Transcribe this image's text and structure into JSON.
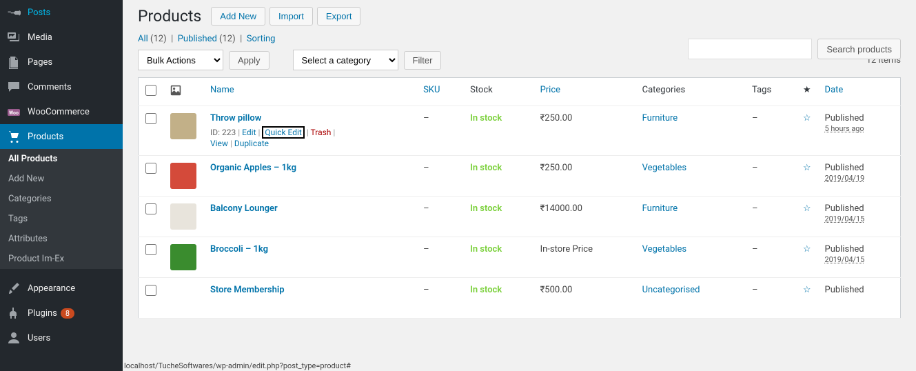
{
  "sidebar": {
    "items": [
      {
        "label": "Posts",
        "icon": "pin"
      },
      {
        "label": "Media",
        "icon": "media"
      },
      {
        "label": "Pages",
        "icon": "pages"
      },
      {
        "label": "Comments",
        "icon": "comment"
      },
      {
        "label": "WooCommerce",
        "icon": "woo"
      },
      {
        "label": "Products",
        "icon": "cart",
        "current": true
      },
      {
        "label": "Appearance",
        "icon": "brush"
      },
      {
        "label": "Plugins",
        "icon": "plug",
        "badge": "8"
      },
      {
        "label": "Users",
        "icon": "user"
      }
    ],
    "submenu": [
      {
        "label": "All Products",
        "current": true
      },
      {
        "label": "Add New"
      },
      {
        "label": "Categories"
      },
      {
        "label": "Tags"
      },
      {
        "label": "Attributes"
      },
      {
        "label": "Product Im-Ex"
      }
    ]
  },
  "header": {
    "title": "Products",
    "add_new": "Add New",
    "import": "Import",
    "export": "Export"
  },
  "filters": {
    "all_label": "All",
    "all_count": "(12)",
    "published_label": "Published",
    "published_count": "(12)",
    "sorting": "Sorting",
    "bulk_actions": "Bulk Actions",
    "apply": "Apply",
    "select_category": "Select a category",
    "filter": "Filter",
    "displaying": "12 items"
  },
  "search": {
    "button": "Search products"
  },
  "columns": {
    "name": "Name",
    "sku": "SKU",
    "stock": "Stock",
    "price": "Price",
    "categories": "Categories",
    "tags": "Tags",
    "date": "Date"
  },
  "row_actions": {
    "id_prefix": "ID: ",
    "edit": "Edit",
    "quick_edit": "Quick Edit",
    "trash": "Trash",
    "view": "View",
    "duplicate": "Duplicate"
  },
  "products": [
    {
      "name": "Throw pillow",
      "id": "223",
      "sku": "–",
      "stock": "In stock",
      "price": "₹250.00",
      "category": "Furniture",
      "tags": "–",
      "pub": "Published",
      "date": "5 hours ago",
      "thumb": "#c2b088",
      "show_actions": true
    },
    {
      "name": "Organic Apples – 1kg",
      "sku": "–",
      "stock": "In stock",
      "price": "₹250.00",
      "category": "Vegetables",
      "tags": "–",
      "pub": "Published",
      "date": "2019/04/19",
      "thumb": "#d44a3a"
    },
    {
      "name": "Balcony Lounger",
      "sku": "–",
      "stock": "In stock",
      "price": "₹14000.00",
      "category": "Furniture",
      "tags": "–",
      "pub": "Published",
      "date": "2019/04/15",
      "thumb": "#e8e4dc"
    },
    {
      "name": "Broccoli – 1kg",
      "sku": "–",
      "stock": "In stock",
      "price": "In-store Price",
      "category": "Vegetables",
      "tags": "–",
      "pub": "Published",
      "date": "2019/04/15",
      "thumb": "#3a8c2e"
    },
    {
      "name": "Store Membership",
      "sku": "–",
      "stock": "In stock",
      "price": "₹500.00",
      "category": "Uncategorised",
      "tags": "–",
      "pub": "Published",
      "date": "",
      "thumb": "#fff"
    }
  ],
  "status_url": "localhost/TucheSoftwares/wp-admin/edit.php?post_type=product#"
}
